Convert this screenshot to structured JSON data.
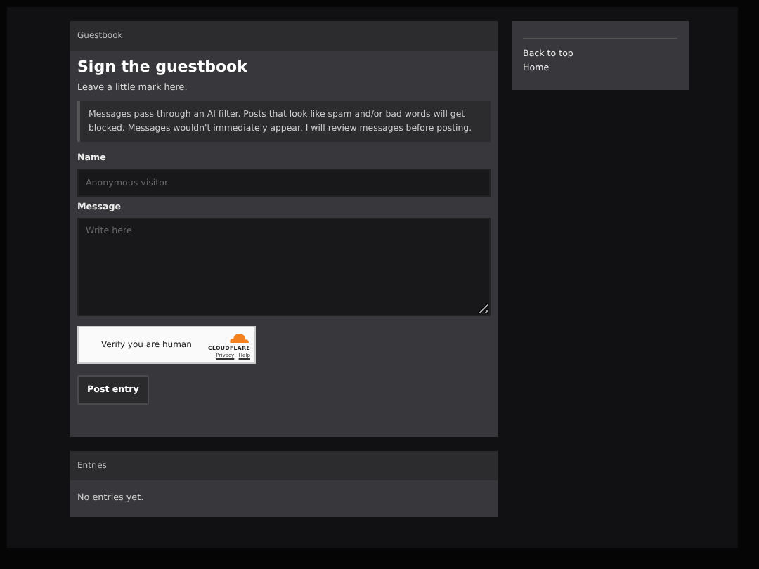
{
  "guestbook": {
    "header": "Guestbook",
    "title": "Sign the guestbook",
    "subtitle": "Leave a little mark here.",
    "notice": "Messages pass through an AI filter. Posts that look like spam and/or bad words will get blocked. Messages wouldn't immediately appear. I will review messages before posting.",
    "name_label": "Name",
    "name_placeholder": "Anonymous visitor",
    "message_label": "Message",
    "message_placeholder": "Write here",
    "captcha": {
      "label": "Verify you are human",
      "brand": "CLOUDFLARE",
      "privacy": "Privacy",
      "separator": "·",
      "help": "Help"
    },
    "submit": "Post entry"
  },
  "entries": {
    "header": "Entries",
    "empty": "No entries yet."
  },
  "sidebar": {
    "links": [
      "Back to top",
      "Home"
    ]
  }
}
